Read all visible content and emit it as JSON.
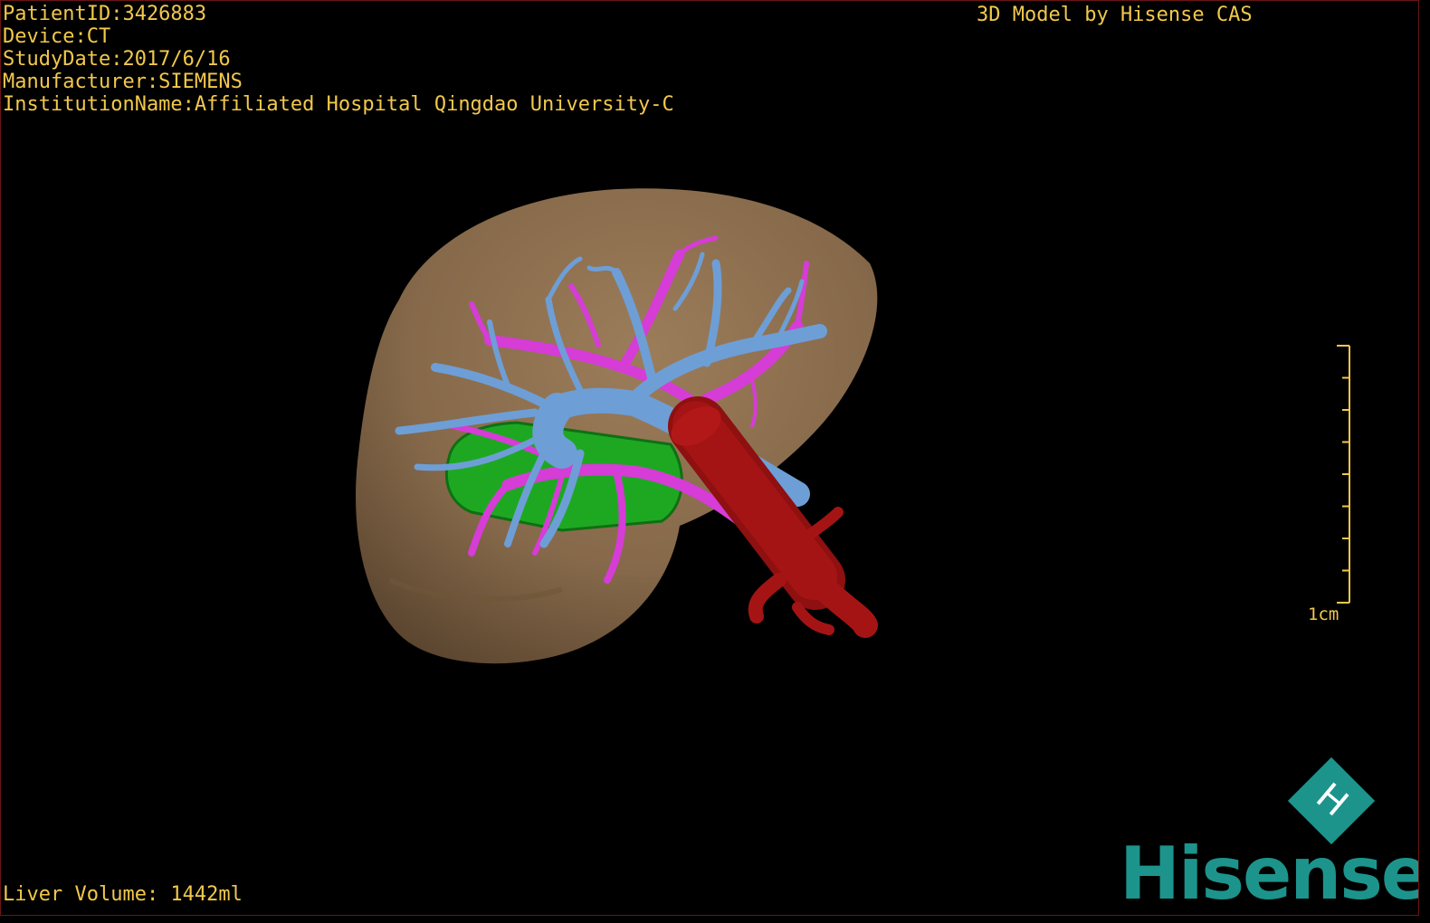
{
  "overlay": {
    "patient_id": "PatientID:3426883",
    "device": "Device:CT",
    "study_date": "StudyDate:2017/6/16",
    "manufacturer": "Manufacturer:SIEMENS",
    "institution": "InstitutionName:Affiliated Hospital Qingdao University-C",
    "title": "3D Model by Hisense CAS",
    "liver_volume": "Liver Volume: 1442ml"
  },
  "scale": {
    "label": "1cm",
    "ticks": 8
  },
  "logo": {
    "wordmark": "Hisense",
    "mark_text": "H"
  },
  "colors": {
    "text": "#f2c84c",
    "liver": "#8c7050",
    "portal_vein": "#6e9ed6",
    "hepatic_vein": "#d63cd6",
    "tumor": "#1ea822",
    "vena_cava": "#a51414",
    "brand": "#1c948c"
  }
}
